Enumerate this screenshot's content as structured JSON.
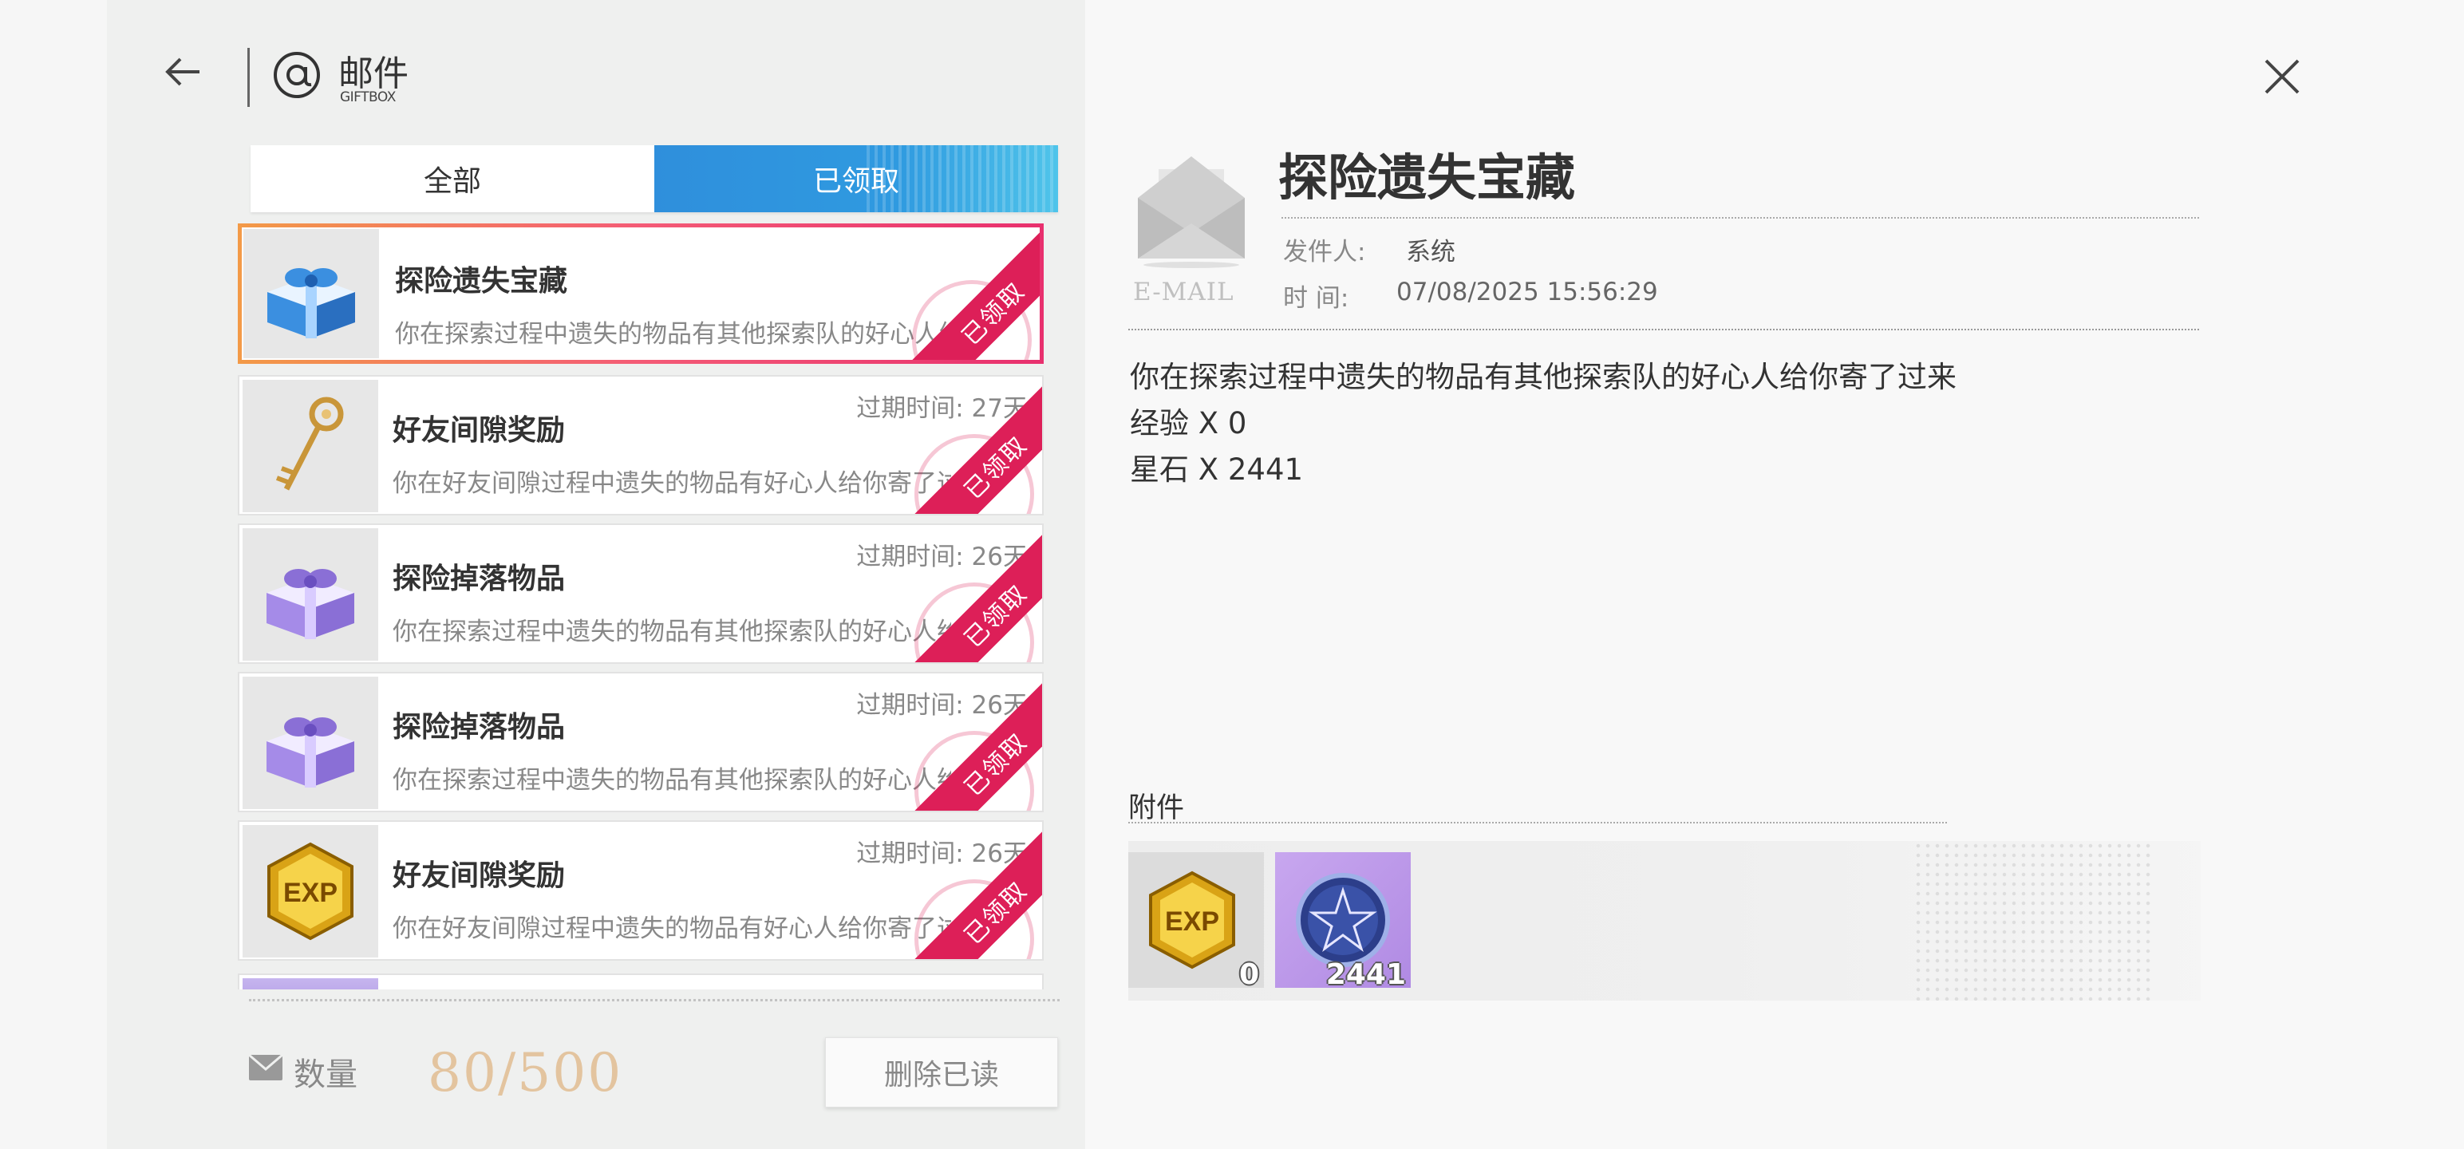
{
  "header": {
    "title": "邮件",
    "subtitle": "GIFTBOX"
  },
  "tabs": [
    {
      "label": "全部",
      "active": false
    },
    {
      "label": "已领取",
      "active": true
    }
  ],
  "mails": [
    {
      "title": "探险遗失宝藏",
      "desc": "你在探索过程中遗失的物品有其他探索队的好心人给你寄了过来",
      "expire": "",
      "status": "已领取",
      "icon": "blue-gift-icon",
      "selected": true
    },
    {
      "title": "好友间隙奖励",
      "desc": "你在好友间隙过程中遗失的物品有好心人给你寄了过来",
      "expire": "过期时间: 27天",
      "status": "已领取",
      "icon": "golden-key-icon",
      "selected": false
    },
    {
      "title": "探险掉落物品",
      "desc": "你在探索过程中遗失的物品有其他探索队的好心人给你寄了过来",
      "expire": "过期时间: 26天",
      "status": "已领取",
      "icon": "purple-gift-icon",
      "selected": false
    },
    {
      "title": "探险掉落物品",
      "desc": "你在探索过程中遗失的物品有其他探索队的好心人给你寄了过来",
      "expire": "过期时间: 26天",
      "status": "已领取",
      "icon": "purple-gift-icon",
      "selected": false
    },
    {
      "title": "好友间隙奖励",
      "desc": "你在好友间隙过程中遗失的物品有好心人给你寄了过来",
      "expire": "过期时间: 26天",
      "status": "已领取",
      "icon": "exp-icon",
      "selected": false
    }
  ],
  "footer": {
    "count_label": "数量",
    "count_value": "80/500",
    "delete_label": "删除已读"
  },
  "detail": {
    "email_caption": "E-MAIL",
    "title": "探险遗失宝藏",
    "sender_label": "发件人:",
    "sender": "系统",
    "time_label": "时  间:",
    "time": "07/08/2025 15:56:29",
    "body": [
      "你在探索过程中遗失的物品有其他探索队的好心人给你寄了过来",
      "经验 X 0",
      "星石 X 2441"
    ],
    "attach_label": "附件",
    "attachments": [
      {
        "icon": "exp-icon",
        "count": "0"
      },
      {
        "icon": "star-stone-icon",
        "count": "2441"
      }
    ]
  },
  "colors": {
    "accent_blue": "#2f95de",
    "claimed_red": "#dd1f58",
    "count_gold": "#e3c49f"
  }
}
